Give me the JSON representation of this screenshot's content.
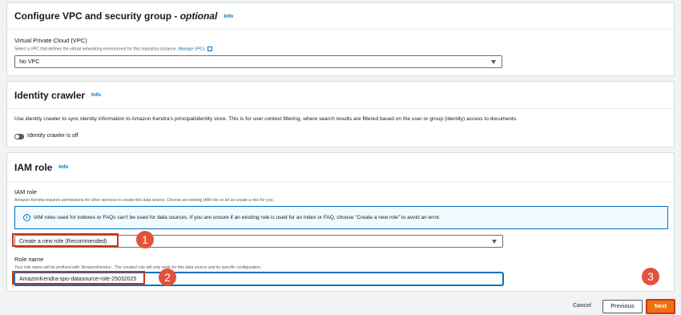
{
  "vpc_section": {
    "title_main": "Configure VPC and security group - ",
    "title_optional": "optional",
    "info": "Info",
    "vpc_label": "Virtual Private Cloud (VPC)",
    "vpc_desc": "Select a VPC that defines the virtual networking environment for this repository instance.",
    "manage_link": "Manage VPCs",
    "vpc_value": "No VPC"
  },
  "identity_section": {
    "title": "Identity crawler",
    "info": "Info",
    "description": "Use identity crawler to sync identity information to Amazon Kendra's principal/identity store. This is for user context filtering, where search results are filtered based on the user or group (identity) access to documents.",
    "toggle_label": "Identity crawler is off"
  },
  "iam_section": {
    "title": "IAM role",
    "info": "Info",
    "role_label": "IAM role",
    "role_desc": "Amazon Kendra requires permissions for other services to create this data source. Choose an existing IAM role or let us create a role for you.",
    "alert_text": "IAM roles used for indexes or FAQs can't be used for data sources. If you are unsure if an existing role is used for an index or FAQ, choose \"Create a new role\" to avoid an error.",
    "role_select_value": "Create a new role (Recommended)",
    "role_name_label": "Role name",
    "role_name_desc": "Your role name will be prefixed with 'AmazonKendra-'. The created role will only work for this data source and its specific configuration.",
    "role_name_value": "AmazonKendra-spo-datasource-role-25032025"
  },
  "markers": [
    "1",
    "2",
    "3"
  ],
  "footer": {
    "cancel": "Cancel",
    "previous": "Previous",
    "next": "Next"
  },
  "colors": {
    "accent": "#0073bb",
    "primary_button": "#ec7211",
    "highlight": "#d13212"
  }
}
